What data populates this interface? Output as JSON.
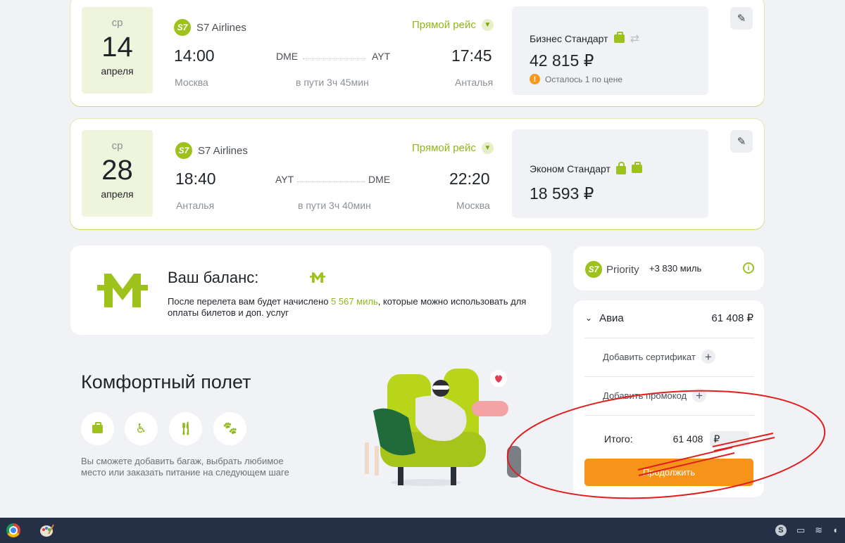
{
  "flights": [
    {
      "weekday": "ср",
      "day": "14",
      "month": "апреля",
      "airline": "S7 Airlines",
      "airline_logo": "S7",
      "direct_label": "Прямой рейс",
      "dep_time": "14:00",
      "dep_city": "Москва",
      "dep_code": "DME",
      "arr_code": "AYT",
      "duration": "в пути 3ч 45мин",
      "arr_time": "17:45",
      "arr_city": "Анталья",
      "fare_name": "Бизнес Стандарт",
      "fare_price": "42 815 ₽",
      "fare_warning": "Осталось 1 по цене",
      "fare_icons": [
        "baggage-icon",
        "exchange-icon"
      ]
    },
    {
      "weekday": "ср",
      "day": "28",
      "month": "апреля",
      "airline": "S7 Airlines",
      "airline_logo": "S7",
      "direct_label": "Прямой рейс",
      "dep_time": "18:40",
      "dep_city": "Анталья",
      "dep_code": "AYT",
      "arr_code": "DME",
      "duration": "в пути 3ч 40мин",
      "arr_time": "22:20",
      "arr_city": "Москва",
      "fare_name": "Эконом Стандарт",
      "fare_price": "18 593 ₽",
      "fare_icons": [
        "hand-luggage-icon",
        "baggage-icon"
      ]
    }
  ],
  "balance": {
    "title": "Ваш баланс:",
    "text_before": "После перелета вам будет начислено ",
    "miles": "5 567 миль",
    "text_after": ", которые можно использовать для оплаты билетов и доп. услуг"
  },
  "comfort": {
    "title": "Комфортный полет",
    "icons": [
      "baggage-icon",
      "seat-icon",
      "meal-icon",
      "pet-icon"
    ],
    "text": "Вы сможете добавить багаж, выбрать любимое место или заказать питание на следующем шаге"
  },
  "priority": {
    "logo": "S7",
    "label": "Priority",
    "miles": "+3 830 миль"
  },
  "summary": {
    "avia_label": "Авиа",
    "avia_price": "61 408 ₽",
    "add_certificate": "Добавить сертификат",
    "add_promo": "Добавить промокод",
    "total_label": "Итого:",
    "total_value": "61 408",
    "currency": "₽",
    "continue": "Продолжить"
  },
  "colors": {
    "accent_green": "#9cc21b",
    "accent_orange": "#f5931b",
    "annotation_red": "#e01e1e"
  }
}
